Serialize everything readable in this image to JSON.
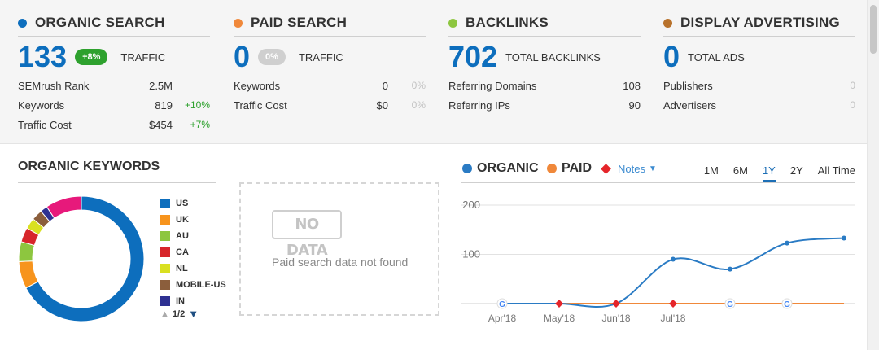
{
  "summary": [
    {
      "id": "organic",
      "title": "ORGANIC SEARCH",
      "dot_color": "#0d6ebd",
      "big_value": "133",
      "badge": "+8%",
      "badge_style": "green",
      "big_label": "TRAFFIC",
      "rows": [
        {
          "label": "SEMrush Rank",
          "value": "2.5M",
          "change": ""
        },
        {
          "label": "Keywords",
          "value": "819",
          "change": "+10%"
        },
        {
          "label": "Traffic Cost",
          "value": "$454",
          "change": "+7%"
        }
      ]
    },
    {
      "id": "paid",
      "title": "PAID SEARCH",
      "dot_color": "#f0883a",
      "big_value": "0",
      "badge": "0%",
      "badge_style": "gray",
      "big_label": "TRAFFIC",
      "rows": [
        {
          "label": "Keywords",
          "value": "0",
          "change": "0%"
        },
        {
          "label": "Traffic Cost",
          "value": "$0",
          "change": "0%"
        }
      ]
    },
    {
      "id": "backlinks",
      "title": "BACKLINKS",
      "dot_color": "#8dc63f",
      "big_value": "702",
      "badge": "",
      "badge_style": "",
      "big_label": "TOTAL BACKLINKS",
      "rows": [
        {
          "label": "Referring Domains",
          "value": "108",
          "change": ""
        },
        {
          "label": "Referring IPs",
          "value": "90",
          "change": ""
        }
      ]
    },
    {
      "id": "display",
      "title": "DISPLAY ADVERTISING",
      "dot_color": "#b8722c",
      "big_value": "0",
      "badge": "",
      "badge_style": "",
      "big_label": "TOTAL ADS",
      "rows": [
        {
          "label": "Publishers",
          "value": "",
          "change": "0"
        },
        {
          "label": "Advertisers",
          "value": "",
          "change": "0"
        }
      ]
    }
  ],
  "organic_keywords": {
    "title": "ORGANIC KEYWORDS",
    "pager": "1/2",
    "legend": [
      {
        "label": "US",
        "color": "#0d6ebd"
      },
      {
        "label": "UK",
        "color": "#f7941d"
      },
      {
        "label": "AU",
        "color": "#8dc63f"
      },
      {
        "label": "CA",
        "color": "#d7262b"
      },
      {
        "label": "NL",
        "color": "#d9e021"
      },
      {
        "label": "MOBILE-US",
        "color": "#8b5e3c"
      },
      {
        "label": "IN",
        "color": "#2e3192"
      }
    ],
    "slices": [
      {
        "label": "US",
        "value": 72
      },
      {
        "label": "UK",
        "value": 7.5
      },
      {
        "label": "AU",
        "value": 5.5
      },
      {
        "label": "CA",
        "value": 4
      },
      {
        "label": "NL",
        "value": 3
      },
      {
        "label": "MOBILE-US",
        "value": 3
      },
      {
        "label": "IN",
        "value": 2
      },
      {
        "label": "other",
        "value": 10,
        "color": "#e7197b"
      }
    ]
  },
  "paid_keywords": {
    "badge": "NO DATA",
    "message": "Paid search data not found"
  },
  "trend": {
    "legend_organic": "ORGANIC",
    "legend_paid": "PAID",
    "notes_label": "Notes",
    "periods": [
      "1M",
      "6M",
      "1Y",
      "2Y",
      "All Time"
    ],
    "active_period": "1Y",
    "colors": {
      "organic": "#2a7bc4",
      "paid": "#f0883a",
      "note": "#e5252a"
    }
  },
  "chart_data": {
    "type": "line",
    "x": [
      "Apr'18",
      "May'18",
      "Jun'18",
      "Jul'18",
      "Aug'18",
      "Sep'18",
      "Oct'18"
    ],
    "x_tick_labels": [
      "Apr'18",
      "May'18",
      "Jun'18",
      "Jul'18",
      "",
      "",
      ""
    ],
    "ylim": [
      0,
      200
    ],
    "yticks": [
      100,
      200
    ],
    "grid": true,
    "series": [
      {
        "name": "ORGANIC",
        "values": [
          0,
          0,
          0,
          90,
          70,
          123,
          133
        ]
      },
      {
        "name": "PAID",
        "values": [
          0,
          0,
          0,
          0,
          0,
          0,
          0
        ]
      }
    ],
    "notes_markers": [
      "May'18",
      "Jun'18",
      "Jul'18",
      "Aug'18"
    ],
    "google_markers": [
      "Apr'18",
      "Aug'18",
      "Sep'18"
    ]
  }
}
